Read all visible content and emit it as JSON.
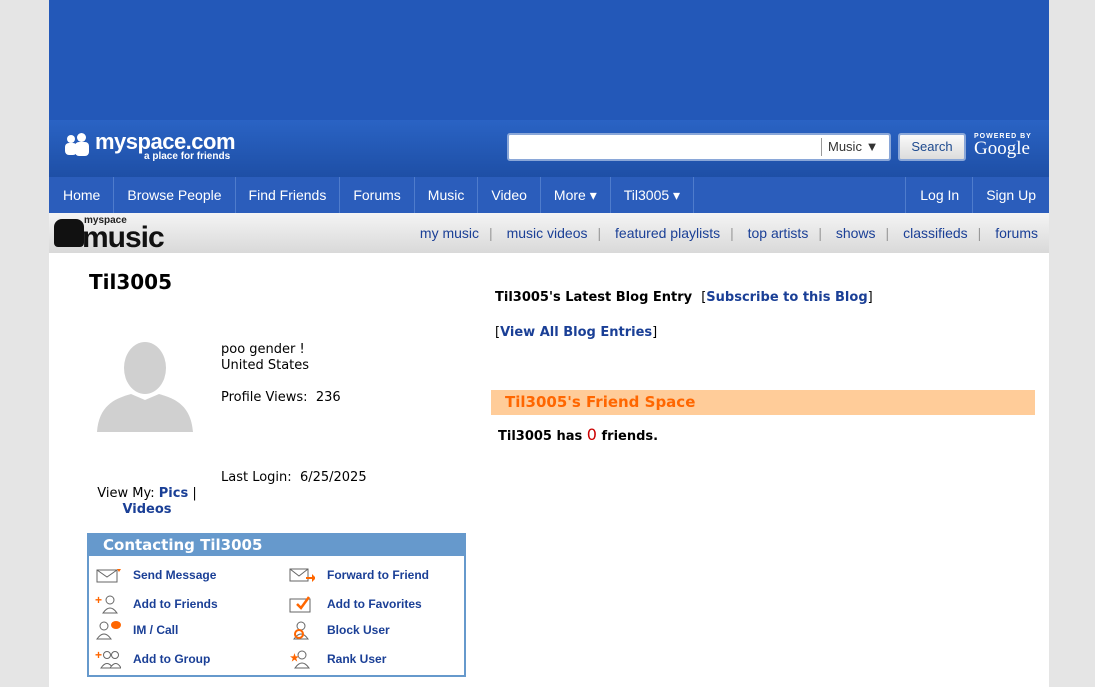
{
  "header": {
    "logo_main": "myspace.com",
    "logo_tagline": "a place for friends",
    "search_placeholder": "",
    "search_category": "Music",
    "search_button": "Search",
    "powered_by": "POWERED BY",
    "powered_google": "Google"
  },
  "nav": {
    "items": [
      "Home",
      "Browse People",
      "Find Friends",
      "Forums",
      "Music",
      "Video",
      "More ▾",
      "Til3005 ▾"
    ],
    "right": [
      "Log In",
      "Sign Up"
    ]
  },
  "music_bar": {
    "logo_small": "myspace",
    "logo_big": "music",
    "links": [
      "my music",
      "music videos",
      "featured playlists",
      "top artists",
      "shows",
      "classifieds",
      "forums"
    ]
  },
  "profile": {
    "name": "Til3005",
    "headline": "poo gender !",
    "country": "United States",
    "views_label": "Profile Views:",
    "views_value": "236",
    "last_login_label": "Last Login:",
    "last_login_value": "6/25/2025",
    "view_my_label": "View My:",
    "pics": "Pics",
    "videos": "Videos",
    "pipe": "|"
  },
  "contact": {
    "title": "Contacting Til3005",
    "items": [
      "Send Message",
      "Forward to Friend",
      "Add to Friends",
      "Add to Favorites",
      "IM / Call",
      "Block User",
      "Add to Group",
      "Rank User"
    ]
  },
  "blog": {
    "latest_label": "Til3005's Latest Blog Entry",
    "subscribe": "Subscribe to this Blog",
    "view_all": "View All Blog Entries",
    "bracket_open": "[",
    "bracket_close": "]"
  },
  "friends": {
    "title": "Til3005's Friend Space",
    "prefix": "Til3005 has",
    "count": "0",
    "suffix": "friends."
  },
  "colors": {
    "header_blue": "#2358b8",
    "link_blue": "#1a3f96",
    "contact_border": "#6699cc",
    "friend_bar": "#ffcc99",
    "friend_title": "#ff6600",
    "count_red": "#cc0000"
  }
}
